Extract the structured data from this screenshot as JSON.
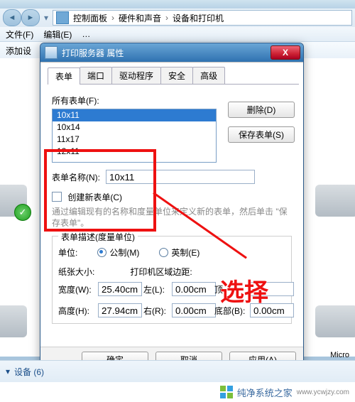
{
  "window": {
    "breadcrumbs": [
      "控制面板",
      "硬件和声音",
      "设备和打印机"
    ],
    "menus": [
      "文件(F)",
      "编辑(E)",
      "…"
    ],
    "toolbar_add_device": "添加设"
  },
  "dialog": {
    "title": "打印服务器 属性",
    "tabs": [
      "表单",
      "端口",
      "驱动程序",
      "安全",
      "高级"
    ],
    "all_forms_label": "所有表单(F):",
    "forms": [
      "10x11",
      "10x14",
      "11x17",
      "12x11"
    ],
    "selected_form_index": 0,
    "btn_delete": "删除(D)",
    "btn_save_form": "保存表单(S)",
    "form_name_label": "表单名称(N):",
    "form_name_value": "10x11",
    "create_new_label": "创建新表单(C)",
    "hint": "通过编辑现有的名称和度量单位来定义新的表单，然后单击 \"保存表单\"。",
    "group_title": "表单描述(度量单位)",
    "units_label": "单位:",
    "unit_metric": "公制(M)",
    "unit_english": "英制(E)",
    "paper_size_label": "纸张大小:",
    "print_area_label": "打印机区域边距:",
    "width_label": "宽度(W):",
    "height_label": "高度(H):",
    "left_label": "左(L):",
    "right_label": "右(R):",
    "top_label": "顶",
    "bottom_label": "底部(B):",
    "width_value": "25.40cm",
    "height_value": "27.94cm",
    "left_value": "0.00cm",
    "right_value": "0.00cm",
    "top_value": "",
    "bottom_value": "0.00cm",
    "btn_ok": "确定",
    "btn_cancel": "取消",
    "btn_apply": "应用(A)"
  },
  "annotation": {
    "label": "选择"
  },
  "footer": {
    "devices_label": "设备 (6)",
    "side_label": "Micro"
  },
  "watermark": {
    "text": "纯净系统之家",
    "url": "www.ycwjzy.com"
  }
}
